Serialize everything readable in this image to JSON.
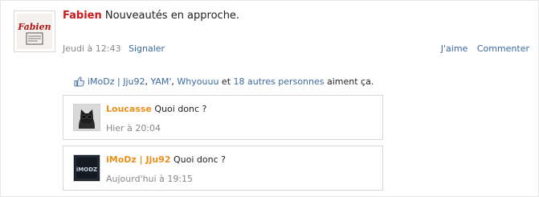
{
  "post": {
    "author": "Fabien",
    "text": "Nouveautés en approche.",
    "timestamp": "Jeudi à 12:43",
    "report_label": "Signaler",
    "like_label": "J'aime",
    "comment_label": "Commenter",
    "avatar_text": "Fabien"
  },
  "likes": {
    "icon": "thumbs-up-icon",
    "names": [
      "iMoDz | Jju92",
      "YAM'",
      "Whyouuu"
    ],
    "connector": "et",
    "others": "18 autres personnes",
    "suffix": "aiment ça."
  },
  "comments": [
    {
      "author": "Loucasse",
      "text": "Quoi donc ?",
      "time": "Hier à 20:04"
    },
    {
      "author": "iMoDz | Jju92",
      "text": "Quoi donc ?",
      "time": "Aujourd'hui à 19:15",
      "avatar_text": "iMODZ"
    }
  ],
  "colors": {
    "link": "#3b6aa0",
    "author_main": "#cc1a1a",
    "comment_author": "#e8901a"
  }
}
